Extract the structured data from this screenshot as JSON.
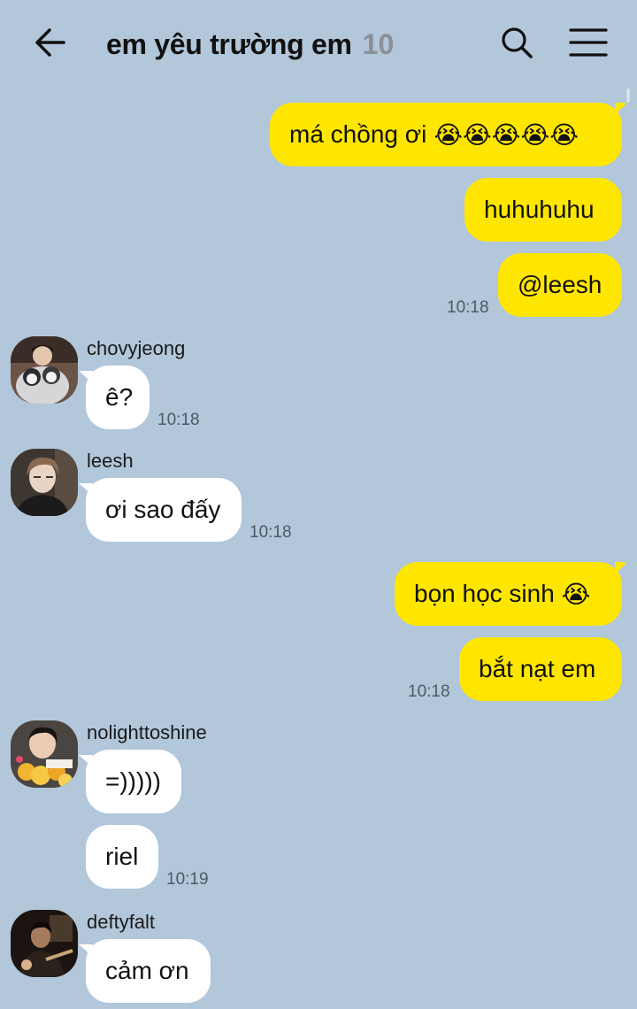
{
  "header": {
    "title": "em yêu trường em",
    "member_count": "10"
  },
  "messages": {
    "m1": {
      "text": "má chồng ơi",
      "emoji": "😭😭😭😭😭"
    },
    "m2": {
      "text": "huhuhuhu"
    },
    "m3": {
      "text": "@leesh",
      "time": "10:18"
    },
    "m4": {
      "sender": "chovyjeong",
      "text": "ê?",
      "time": "10:18"
    },
    "m5": {
      "sender": "leesh",
      "text": "ơi sao đấy",
      "time": "10:18"
    },
    "m6": {
      "text": "bọn học sinh",
      "emoji": "😭"
    },
    "m7": {
      "text": "bắt nạt em",
      "time": "10:18"
    },
    "m8": {
      "sender": "nolighttoshine",
      "text": "=)))))"
    },
    "m9": {
      "text": "riel",
      "time": "10:19"
    },
    "m10": {
      "sender": "deftyfalt",
      "text": "cảm ơn"
    }
  },
  "colors": {
    "background": "#b2c7da",
    "my_bubble": "#fee600",
    "other_bubble": "#ffffff"
  }
}
